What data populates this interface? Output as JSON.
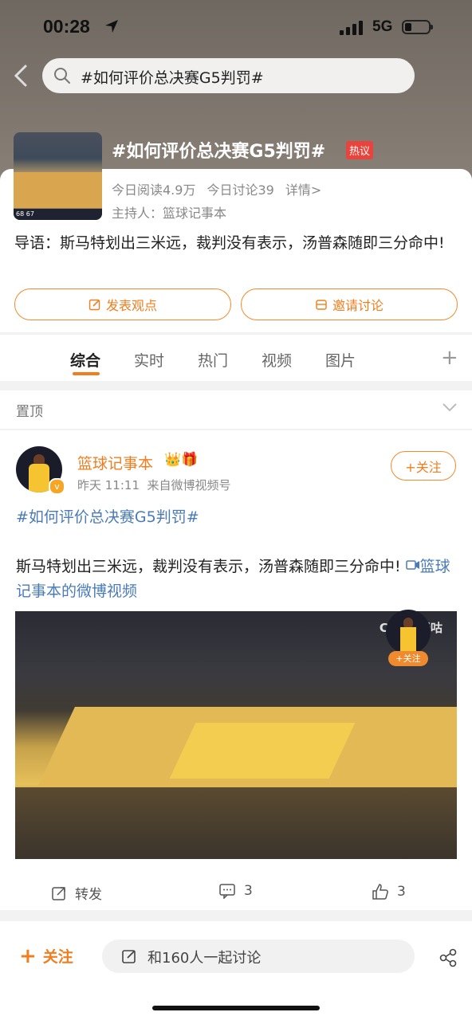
{
  "status": {
    "time": "00:28",
    "network": "5G"
  },
  "search": {
    "query": "#如何评价总决赛G5判罚#"
  },
  "topic": {
    "title": "#如何评价总决赛G5判罚#",
    "tag": "热议",
    "reads": "今日阅读4.9万",
    "discussions": "今日讨论39",
    "details": "详情>",
    "host": "主持人：篮球记事本",
    "guide": "导语：斯马特划出三米远，裁判没有表示，汤普森随即三分命中!",
    "post_button": "发表观点",
    "invite_button": "邀请讨论",
    "thumb_score": "68  67"
  },
  "tabs": [
    "综合",
    "实时",
    "热门",
    "视频",
    "图片"
  ],
  "pinned": {
    "label": "置顶"
  },
  "post": {
    "author": "篮球记事本",
    "author_emoji": "👑🎁",
    "time": "昨天 11:11",
    "source": "来自微博视频号",
    "follow": "+关注",
    "hashtag": "#如何评价总决赛G5判罚#",
    "body": "斯马特划出三米远，裁判没有表示，汤普森随即三分命中!",
    "video_link": "篮球记事本的微博视频",
    "video_logo": "CCTV 咪咕",
    "mini_follow": "+关注",
    "repost": "转发",
    "comments": "3",
    "likes": "3"
  },
  "bottom": {
    "follow": "关注",
    "input_placeholder": "和160人一起讨论"
  }
}
